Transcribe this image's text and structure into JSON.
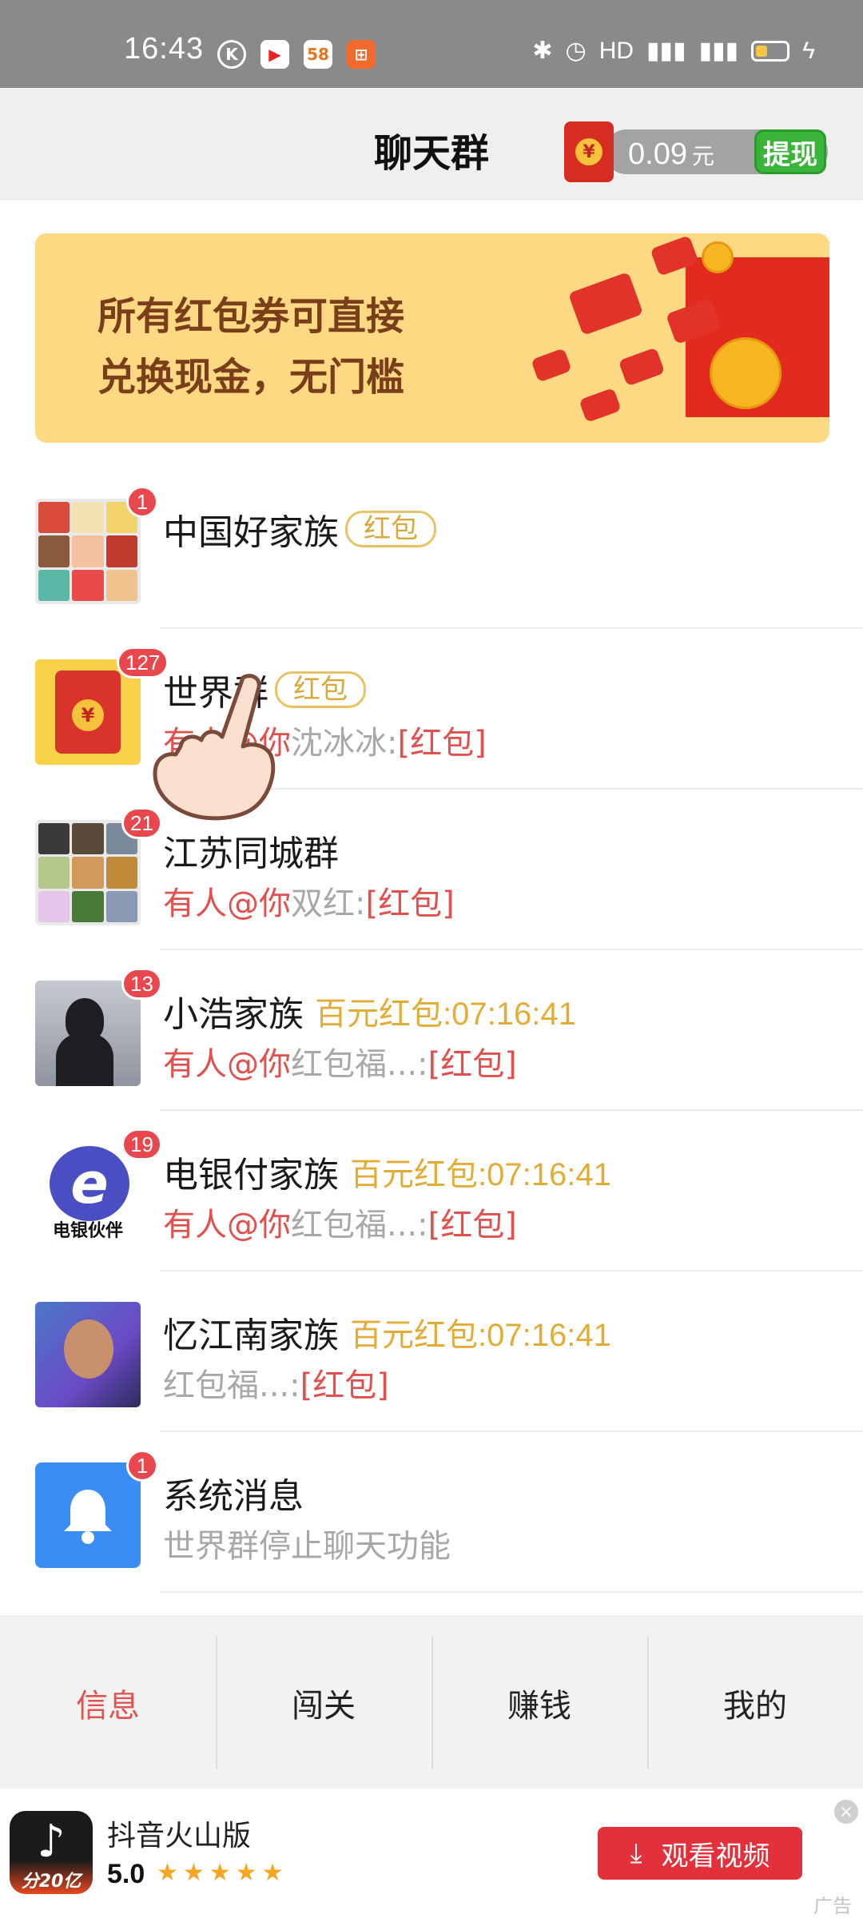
{
  "status_bar": {
    "time": "16:43",
    "network": "HD",
    "icons": [
      "k-app-icon",
      "video-app-icon",
      "58-app-icon",
      "grid-app-icon",
      "bluetooth-icon",
      "alarm-icon",
      "signal-4g-icon",
      "signal-4g-icon",
      "battery-icon",
      "charging-icon"
    ],
    "app_labels": [
      "K",
      "▶",
      "58",
      "⊞"
    ]
  },
  "header": {
    "title": "聊天群",
    "wallet_amount": "0.09",
    "wallet_unit": "元",
    "withdraw_label": "提现",
    "envelope_symbol": "¥"
  },
  "banner": {
    "line1": "所有红包券可直接",
    "line2": "兑换现金，无门槛"
  },
  "chats": [
    {
      "name": "中国好家族",
      "tag": "红包",
      "timer": "",
      "badge": "1",
      "at": "",
      "sender": "",
      "hb": "",
      "gray": ""
    },
    {
      "name": "世界群",
      "tag": "红包",
      "timer": "",
      "badge": "127",
      "at": "有人@你",
      "sender": "沈冰冰:",
      "hb": "[红包]",
      "gray": ""
    },
    {
      "name": "江苏同城群",
      "tag": "",
      "timer": "",
      "badge": "21",
      "at": "有人@你",
      "sender": "双红:",
      "hb": "[红包]",
      "gray": ""
    },
    {
      "name": "小浩家族",
      "tag": "",
      "timer": "百元红包:07:16:41",
      "badge": "13",
      "at": "有人@你",
      "sender": "红包福...:",
      "hb": "[红包]",
      "gray": ""
    },
    {
      "name": "电银付家族",
      "tag": "",
      "timer": "百元红包:07:16:41",
      "badge": "19",
      "at": "有人@你",
      "sender": "红包福...:",
      "hb": "[红包]",
      "gray": ""
    },
    {
      "name": "忆江南家族",
      "tag": "",
      "timer": "百元红包:07:16:41",
      "badge": "",
      "at": "",
      "sender": "红包福...:",
      "hb": "[红包]",
      "gray": ""
    },
    {
      "name": "系统消息",
      "tag": "",
      "timer": "",
      "badge": "1",
      "at": "",
      "sender": "",
      "hb": "",
      "gray": "世界群停止聊天功能"
    }
  ],
  "avatar_labels": {
    "redpacket": "¥",
    "logo_letter": "e",
    "logo_caption": "电银伙伴"
  },
  "tabs": [
    {
      "label": "信息",
      "active": true
    },
    {
      "label": "闯关",
      "active": false
    },
    {
      "label": "赚钱",
      "active": false
    },
    {
      "label": "我的",
      "active": false
    }
  ],
  "ad": {
    "app_name": "抖音火山版",
    "rating": "5.0",
    "stars": "★★★★★",
    "button_label": "观看视频",
    "icon_sub": "分20亿",
    "close": "×",
    "label": "广告"
  },
  "colors": {
    "accent_red": "#e2504e",
    "gold": "#e2ad36",
    "withdraw_green": "#3ab53a",
    "banner_bg": "#fdd983",
    "tab_active": "#e25452"
  }
}
